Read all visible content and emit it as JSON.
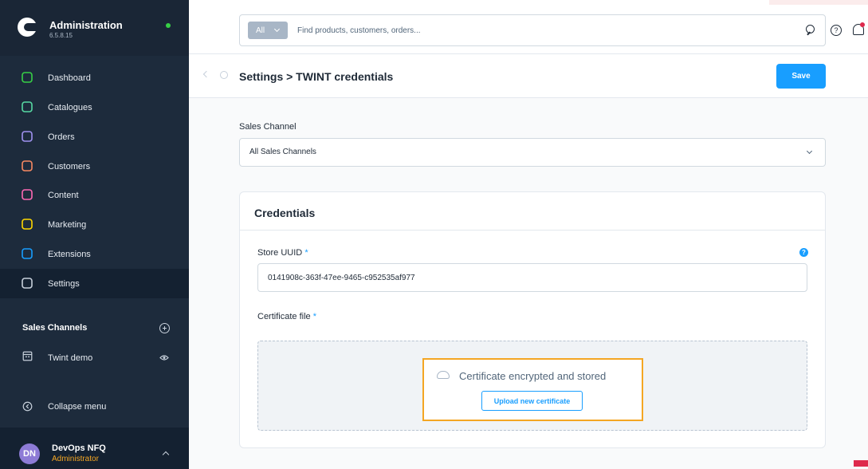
{
  "brand": {
    "title": "Administration",
    "version": "6.5.8.15"
  },
  "nav": [
    {
      "label": "Dashboard",
      "icon": "dashboard-icon",
      "color": "#37d046"
    },
    {
      "label": "Catalogues",
      "icon": "catalogues-icon",
      "color": "#57d9a3"
    },
    {
      "label": "Orders",
      "icon": "orders-icon",
      "color": "#a092f0"
    },
    {
      "label": "Customers",
      "icon": "customers-icon",
      "color": "#f88962"
    },
    {
      "label": "Content",
      "icon": "content-icon",
      "color": "#ff68b4"
    },
    {
      "label": "Marketing",
      "icon": "marketing-icon",
      "color": "#ffd700"
    },
    {
      "label": "Extensions",
      "icon": "extensions-icon",
      "color": "#189eff"
    },
    {
      "label": "Settings",
      "icon": "settings-icon",
      "color": "#c7d0db"
    }
  ],
  "sales_channels": {
    "title": "Sales Channels",
    "items": [
      {
        "label": "Twint demo"
      }
    ]
  },
  "collapse_label": "Collapse menu",
  "user": {
    "initials": "DN",
    "name": "DevOps NFQ",
    "role": "Administrator"
  },
  "search": {
    "scope": "All",
    "placeholder": "Find products, customers, orders..."
  },
  "page": {
    "title": "Settings > TWINT credentials",
    "save_label": "Save"
  },
  "sales_channel_field": {
    "label": "Sales Channel",
    "value": "All Sales Channels"
  },
  "credentials": {
    "title": "Credentials",
    "store_uuid_label": "Store UUID",
    "store_uuid_value": "0141908c-363f-47ee-9465-c952535af977",
    "certificate_label": "Certificate file",
    "certificate_status": "Certificate encrypted and stored",
    "upload_label": "Upload new certificate",
    "required_mark": "*"
  },
  "colors": {
    "accent": "#189eff",
    "sidebar": "#1d2b3c",
    "highlight": "#f4a623"
  }
}
